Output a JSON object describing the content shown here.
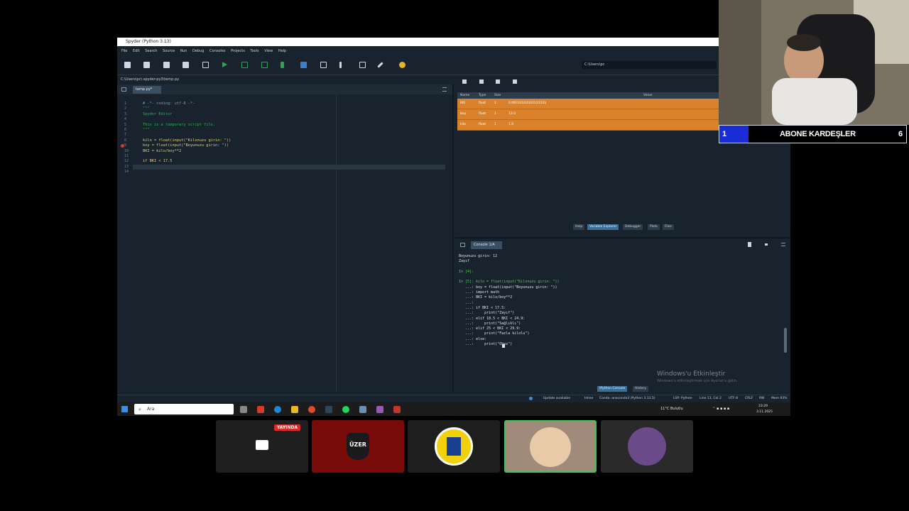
{
  "window": {
    "title": "Spyder (Python 3.13)"
  },
  "menu": [
    "File",
    "Edit",
    "Search",
    "Source",
    "Run",
    "Debug",
    "Consoles",
    "Projects",
    "Tools",
    "View",
    "Help"
  ],
  "toolbar": {
    "working_dir": "C:\\Users\\pc"
  },
  "editor": {
    "path": "C:\\Users\\pc\\.spyder-py3\\temp.py",
    "tab": "temp.py*",
    "line_numbers": [
      "1",
      "2",
      "3",
      "4",
      "5",
      "6",
      "7",
      "8",
      "9",
      "10",
      "11",
      "12",
      "13",
      "14"
    ],
    "lines": [
      "# -*- coding: utf-8 -*-",
      "\"\"\"",
      "Spyder Editor",
      "",
      "This is a temporary script file.",
      "\"\"\"",
      "",
      "kilo = float(input(\"Kilonuzu girin: \"))",
      "boy = float(input(\"Boyunuzu girin: \"))",
      "BKI = kilo/boy**2",
      "",
      "if BKI < 17.5",
      "",
      ""
    ]
  },
  "variables": {
    "headers": [
      "Name",
      "Type",
      "Size",
      "Value"
    ],
    "rows": [
      {
        "name": "BKI",
        "type": "float",
        "size": "1",
        "value": "0.08333333333333333"
      },
      {
        "name": "boy",
        "type": "float",
        "size": "1",
        "value": "12.0"
      },
      {
        "name": "kilo",
        "type": "float",
        "size": "1",
        "value": "1.0"
      }
    ]
  },
  "pane_tabs": [
    "Help",
    "Variable Explorer",
    "Debugger",
    "Plots",
    "Files"
  ],
  "console": {
    "tab": "Console 1/A",
    "lines": [
      "Boyunuzu girin: 12",
      "Zayıf",
      "",
      "In [4]:",
      "",
      "In [5]: kilo = float(input(\"Kilonuzu girin: \"))",
      "   ...: boy = float(input(\"Boyunuzu girin: \"))",
      "   ...: import math",
      "   ...: BKI = kilo/boy**2",
      "   ...:",
      "   ...: if BKI < 17.5:",
      "   ...:     print(\"Zayıf\")",
      "   ...: elif 18.5 < BKI < 24.9:",
      "   ...:     print(\"Sağlıklı\")",
      "   ...: elif 25 < BKI < 29.9:",
      "   ...:     print(\"Fazla kilolu\")",
      "   ...: else:",
      "   ...:     print(\"Obez\")"
    ],
    "watermark_title": "Windows'u Etkinleştir",
    "watermark_sub": "Windows'u etkinleştirmek için Ayarlar'a gidin.",
    "bottom_tabs": [
      "IPython Console",
      "History"
    ]
  },
  "status": {
    "update": "Update available",
    "inline": "Inline",
    "conda": "Conda: anaconda3 (Python 3.13.5)",
    "lsp": "LSP: Python",
    "cursor": "Line 13, Col 2",
    "encoding": "UTF-8",
    "eol": "CRLF",
    "rw": "RW",
    "mem": "Mem 93%"
  },
  "taskbar": {
    "search_placeholder": "Ara",
    "weather": "11°C Bulutlu",
    "time": "23:29",
    "date": "3.11.2025"
  },
  "overlay": {
    "abone_num": "1",
    "abone_text": "ABONE KARDEŞLER",
    "abone_count": "6"
  },
  "tiles": {
    "live_badge": "YAYINDA",
    "uzer": "ÜZER"
  }
}
